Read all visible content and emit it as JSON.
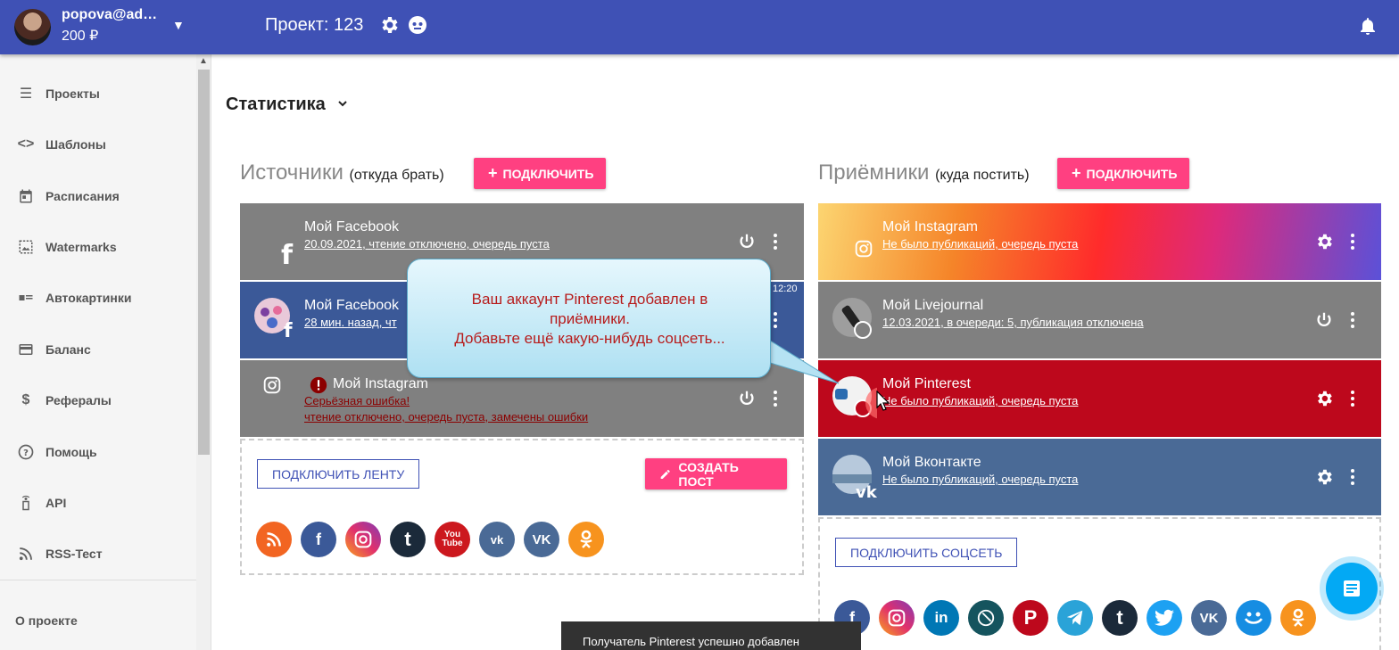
{
  "header": {
    "user_email": "popova@ad…",
    "user_balance": "200 ₽",
    "project_title": "Проект: 123"
  },
  "sidebar": {
    "items": [
      {
        "label": "Проекты",
        "icon": "list-icon"
      },
      {
        "label": "Шаблоны",
        "icon": "code-icon"
      },
      {
        "label": "Расписания",
        "icon": "calendar-icon"
      },
      {
        "label": "Watermarks",
        "icon": "image-icon"
      },
      {
        "label": "Автокартинки",
        "icon": "picture-text-icon"
      },
      {
        "label": "Баланс",
        "icon": "credit-card-icon"
      },
      {
        "label": "Рефералы",
        "icon": "dollar-icon"
      },
      {
        "label": "Помощь",
        "icon": "help-icon"
      },
      {
        "label": "API",
        "icon": "api-icon"
      },
      {
        "label": "RSS-Тест",
        "icon": "rss-icon"
      }
    ],
    "about": "О проекте"
  },
  "main": {
    "stat_title": "Статистика"
  },
  "sources": {
    "title": "Источники",
    "subtitle": "(откуда брать)",
    "connect_label": "ПОДКЛЮЧИТЬ",
    "cards": [
      {
        "name": "Мой Facebook",
        "status": "20.09.2021, чтение отключено, очередь пуста"
      },
      {
        "name": "Мой Facebook",
        "status": "28 мин. назад, чт",
        "time": "12:20"
      },
      {
        "name": "Мой Instagram",
        "error": "Серьёзная ошибка!",
        "status": "чтение отключено, очередь пуста, замечены ошибки"
      }
    ],
    "feed_button": "ПОДКЛЮЧИТЬ ЛЕНТУ",
    "create_post_button": "СОЗДАТЬ ПОСТ"
  },
  "receivers": {
    "title": "Приёмники",
    "subtitle": "(куда постить)",
    "connect_label": "ПОДКЛЮЧИТЬ",
    "cards": [
      {
        "name": "Мой Instagram",
        "status": "Не было публикаций, очередь пуста"
      },
      {
        "name": "Мой Livejournal",
        "status": "12.03.2021, в очереди: 5, публикация отключена"
      },
      {
        "name": "Мой Pinterest",
        "status": "Не было публикаций, очередь пуста"
      },
      {
        "name": "Мой Вконтакте",
        "status": "Не было публикаций, очередь пуста"
      }
    ],
    "social_button": "ПОДКЛЮЧИТЬ СОЦСЕТЬ"
  },
  "callout": {
    "line1": "Ваш аккаунт Pinterest добавлен в",
    "line2": "приёмники.",
    "line3": "Добавьте ещё какую-нибудь соцсеть..."
  },
  "toast": "Получатель Pinterest успешно добавлен",
  "colors": {
    "primary": "#3f51b5",
    "accent": "#ff4081",
    "card_gray": "#808080",
    "facebook": "#3b5998",
    "pinterest": "#bd081c",
    "vk": "#4a6a96"
  }
}
